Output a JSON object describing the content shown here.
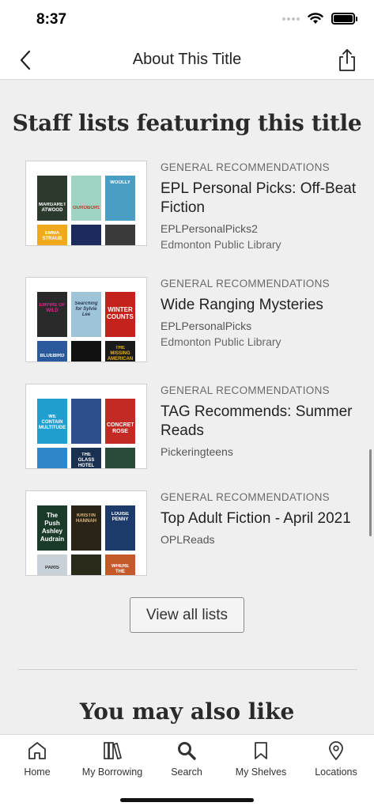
{
  "status_bar": {
    "time": "8:37"
  },
  "header": {
    "title": "About This Title"
  },
  "staff_lists": {
    "title": "Staff lists featuring this title",
    "items": [
      {
        "category": "GENERAL RECOMMENDATIONS",
        "name": "EPL Personal Picks: Off-Beat Fiction",
        "owner": "EPLPersonalPicks2",
        "library": "Edmonton Public Library",
        "covers_top": [
          {
            "text": "MARGARET ATWOOD",
            "color": "#2c3a2e"
          },
          {
            "text": "OUROBOROS",
            "color": "#9fd4c4"
          },
          {
            "text": "WOOLLY",
            "color": "#4a9ec4"
          }
        ],
        "covers_bottom": [
          {
            "text": "EMMA STRAUB",
            "color": "#f0a81c"
          },
          {
            "text": "",
            "color": "#1d2a5c"
          },
          {
            "text": "",
            "color": "#3a3a3a"
          }
        ]
      },
      {
        "category": "GENERAL RECOMMENDATIONS",
        "name": "Wide Ranging Mysteries",
        "owner": "EPLPersonalPicks",
        "library": "Edmonton Public Library",
        "covers_top": [
          {
            "text": "EMPIRE OF WILD",
            "color": "#2a2a2a"
          },
          {
            "text": "Searching for Sylvie Lee",
            "color": "#9ec4d8"
          },
          {
            "text": "WINTER COUNTS",
            "color": "#c4221c"
          }
        ],
        "covers_bottom": [
          {
            "text": "BLUEBIRD",
            "color": "#2a5a9c"
          },
          {
            "text": "",
            "color": "#111111"
          },
          {
            "text": "THE MISSING AMERICAN",
            "color": "#1a1a1a"
          }
        ]
      },
      {
        "category": "GENERAL RECOMMENDATIONS",
        "name": "TAG Recommends: Summer Reads",
        "owner": "Pickeringteens",
        "library": "",
        "covers_top": [
          {
            "text": "WE CONTAIN MULTITUDES",
            "color": "#1e9fd0"
          },
          {
            "text": "",
            "color": "#2c4f8c"
          },
          {
            "text": "CONCRETE ROSE",
            "color": "#c42a24"
          }
        ],
        "covers_bottom": [
          {
            "text": "",
            "color": "#2f86c8"
          },
          {
            "text": "THE GLASS HOTEL",
            "color": "#1a3050"
          },
          {
            "text": "",
            "color": "#2a4a3a"
          }
        ]
      },
      {
        "category": "GENERAL RECOMMENDATIONS",
        "name": "Top Adult Fiction - April 2021",
        "owner": "OPLReads",
        "library": "",
        "covers_top": [
          {
            "text": "The Push Ashley Audrain",
            "color": "#1a3a2a"
          },
          {
            "text": "KRISTIN HANNAH",
            "color": "#2a2418"
          },
          {
            "text": "LOUISE PENNY",
            "color": "#1c3a6a"
          }
        ],
        "covers_bottom": [
          {
            "text": "PARIS",
            "color": "#c8d0d8"
          },
          {
            "text": "",
            "color": "#2a2a1a"
          },
          {
            "text": "WHERE THE",
            "color": "#c45a2a"
          }
        ]
      }
    ],
    "view_all_label": "View all lists"
  },
  "also_like": {
    "title": "You may also like"
  },
  "tab_bar": {
    "tabs": [
      {
        "label": "Home",
        "icon": "home-icon"
      },
      {
        "label": "My Borrowing",
        "icon": "books-icon"
      },
      {
        "label": "Search",
        "icon": "search-icon"
      },
      {
        "label": "My Shelves",
        "icon": "bookmark-icon"
      },
      {
        "label": "Locations",
        "icon": "location-pin-icon"
      }
    ]
  }
}
